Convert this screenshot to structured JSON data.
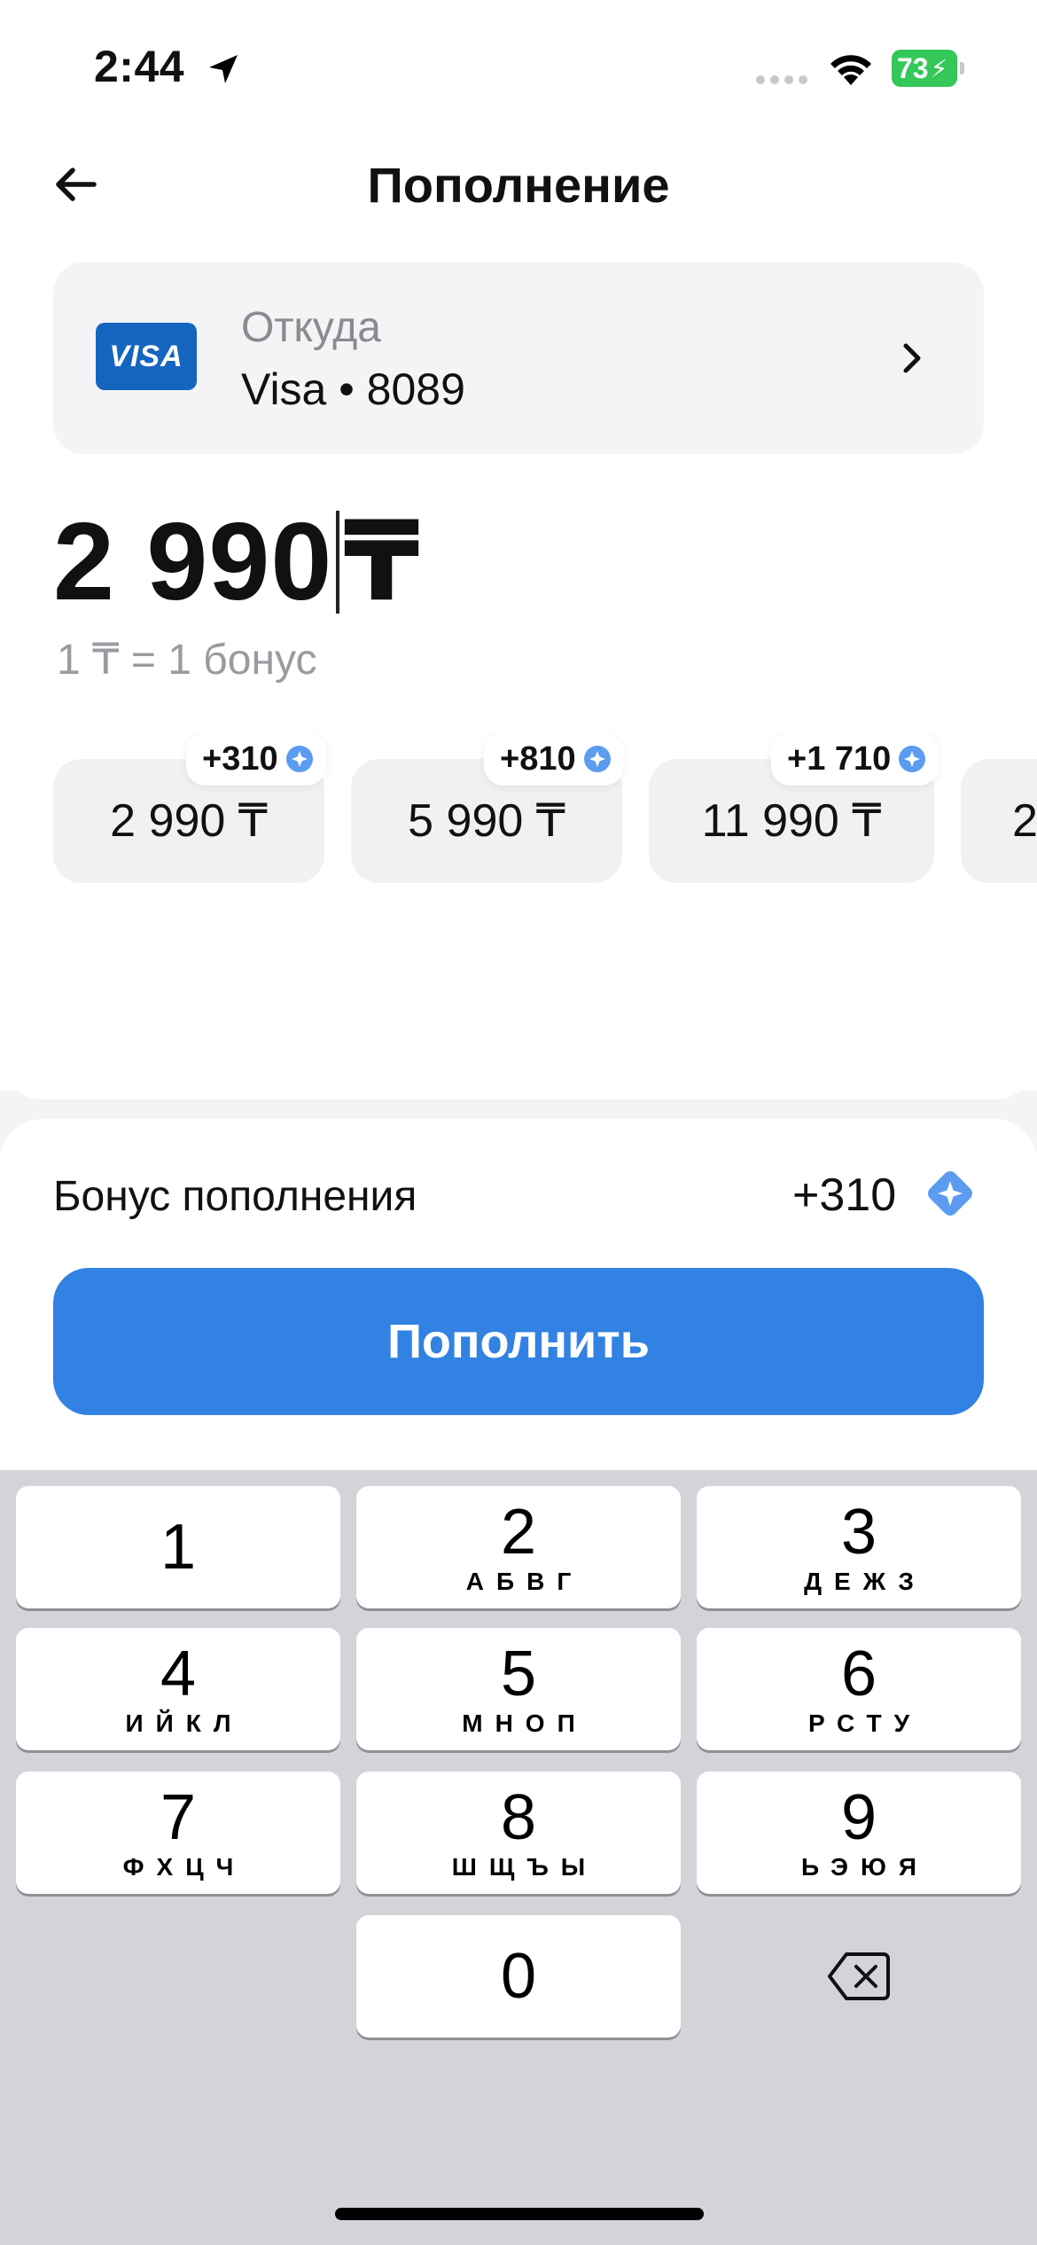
{
  "status_bar": {
    "time": "2:44",
    "battery": "73",
    "location_icon": "location-arrow-icon",
    "wifi_icon": "wifi-icon"
  },
  "nav": {
    "title": "Пополнение",
    "back_icon": "arrow-left-icon"
  },
  "source": {
    "label": "Откуда",
    "value": "Visa • 8089",
    "logo_text": "VISA",
    "chevron_icon": "chevron-right-icon"
  },
  "amount": {
    "value": "2 990",
    "currency": "₸",
    "rate_text": "1 ₸ = 1 бонус"
  },
  "presets": [
    {
      "amount": "2 990 ₸",
      "bonus": "+310"
    },
    {
      "amount": "5 990 ₸",
      "bonus": "+810"
    },
    {
      "amount": "11 990 ₸",
      "bonus": "+1 710"
    },
    {
      "amount": "2",
      "bonus": ""
    }
  ],
  "bonus": {
    "label": "Бонус пополнения",
    "value": "+310",
    "icon": "bonus-gem-icon"
  },
  "action": {
    "topup_label": "Пополнить"
  },
  "keyboard": {
    "keys": [
      {
        "digit": "1",
        "letters": ""
      },
      {
        "digit": "2",
        "letters": "АБВГ"
      },
      {
        "digit": "3",
        "letters": "ДЕЖЗ"
      },
      {
        "digit": "4",
        "letters": "ИЙКЛ"
      },
      {
        "digit": "5",
        "letters": "МНОП"
      },
      {
        "digit": "6",
        "letters": "РСТУ"
      },
      {
        "digit": "7",
        "letters": "ФХЦЧ"
      },
      {
        "digit": "8",
        "letters": "ШЩЪЫ"
      },
      {
        "digit": "9",
        "letters": "ЬЭЮЯ"
      },
      {
        "digit": "0",
        "letters": ""
      }
    ],
    "backspace_icon": "backspace-icon"
  },
  "colors": {
    "accent": "#3182e2",
    "battery": "#34c759",
    "visa": "#1565c0",
    "gem": "#5b9cf0"
  }
}
